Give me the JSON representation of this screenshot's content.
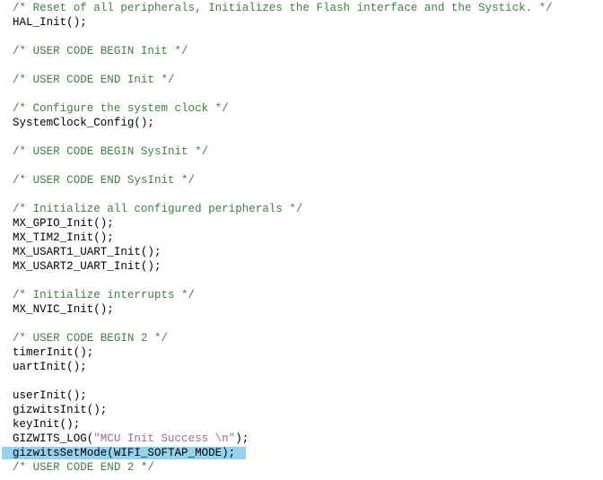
{
  "editor": {
    "name": "c-source-code-view",
    "background_color": "#ffffff",
    "font_size_px": 12.5,
    "line_height_px": 16,
    "colors": {
      "comment": "#3f7f3f",
      "string": "#9a6a96",
      "plain_text": "#000000",
      "selection_highlight": "#96d2f0"
    },
    "selected_line_index": 32,
    "lines": [
      {
        "tokens": [
          {
            "t": "comment",
            "s": "/* Reset of all peripherals, Initializes the Flash interface and the Systick. */"
          }
        ]
      },
      {
        "tokens": [
          {
            "t": "plain",
            "s": "HAL_Init();"
          }
        ]
      },
      {
        "tokens": [
          {
            "t": "plain",
            "s": ""
          }
        ]
      },
      {
        "tokens": [
          {
            "t": "comment",
            "s": "/* USER CODE BEGIN Init */"
          }
        ]
      },
      {
        "tokens": [
          {
            "t": "plain",
            "s": ""
          }
        ]
      },
      {
        "tokens": [
          {
            "t": "comment",
            "s": "/* USER CODE END Init */"
          }
        ]
      },
      {
        "tokens": [
          {
            "t": "plain",
            "s": ""
          }
        ]
      },
      {
        "tokens": [
          {
            "t": "comment",
            "s": "/* Configure the system clock */"
          }
        ]
      },
      {
        "tokens": [
          {
            "t": "plain",
            "s": "SystemClock_Config();"
          }
        ]
      },
      {
        "tokens": [
          {
            "t": "plain",
            "s": ""
          }
        ]
      },
      {
        "tokens": [
          {
            "t": "comment",
            "s": "/* USER CODE BEGIN SysInit */"
          }
        ]
      },
      {
        "tokens": [
          {
            "t": "plain",
            "s": ""
          }
        ]
      },
      {
        "tokens": [
          {
            "t": "comment",
            "s": "/* USER CODE END SysInit */"
          }
        ]
      },
      {
        "tokens": [
          {
            "t": "plain",
            "s": ""
          }
        ]
      },
      {
        "tokens": [
          {
            "t": "comment",
            "s": "/* Initialize all configured peripherals */"
          }
        ]
      },
      {
        "tokens": [
          {
            "t": "plain",
            "s": "MX_GPIO_Init();"
          }
        ]
      },
      {
        "tokens": [
          {
            "t": "plain",
            "s": "MX_TIM2_Init();"
          }
        ]
      },
      {
        "tokens": [
          {
            "t": "plain",
            "s": "MX_USART1_UART_Init();"
          }
        ]
      },
      {
        "tokens": [
          {
            "t": "plain",
            "s": "MX_USART2_UART_Init();"
          }
        ]
      },
      {
        "tokens": [
          {
            "t": "plain",
            "s": ""
          }
        ]
      },
      {
        "tokens": [
          {
            "t": "comment",
            "s": "/* Initialize interrupts */"
          }
        ]
      },
      {
        "tokens": [
          {
            "t": "plain",
            "s": "MX_NVIC_Init();"
          }
        ]
      },
      {
        "tokens": [
          {
            "t": "plain",
            "s": ""
          }
        ]
      },
      {
        "tokens": [
          {
            "t": "comment",
            "s": "/* USER CODE BEGIN 2 */"
          }
        ]
      },
      {
        "tokens": [
          {
            "t": "plain",
            "s": "timerInit();"
          }
        ]
      },
      {
        "tokens": [
          {
            "t": "plain",
            "s": "uartInit();"
          }
        ]
      },
      {
        "tokens": [
          {
            "t": "plain",
            "s": ""
          }
        ]
      },
      {
        "tokens": [
          {
            "t": "plain",
            "s": "userInit();"
          }
        ]
      },
      {
        "tokens": [
          {
            "t": "plain",
            "s": "gizwitsInit();"
          }
        ]
      },
      {
        "tokens": [
          {
            "t": "plain",
            "s": "keyInit();"
          }
        ]
      },
      {
        "tokens": [
          {
            "t": "plain",
            "s": "GIZWITS_LOG("
          },
          {
            "t": "string",
            "s": "\"MCU Init Success \\n\""
          },
          {
            "t": "plain",
            "s": ");"
          }
        ]
      },
      {
        "tokens": [
          {
            "t": "plain",
            "s": "gizwitsSetMode(WIFI_SOFTAP_MODE);"
          }
        ],
        "selected": true
      },
      {
        "tokens": [
          {
            "t": "comment",
            "s": "/* USER CODE END 2 */"
          }
        ]
      }
    ]
  }
}
